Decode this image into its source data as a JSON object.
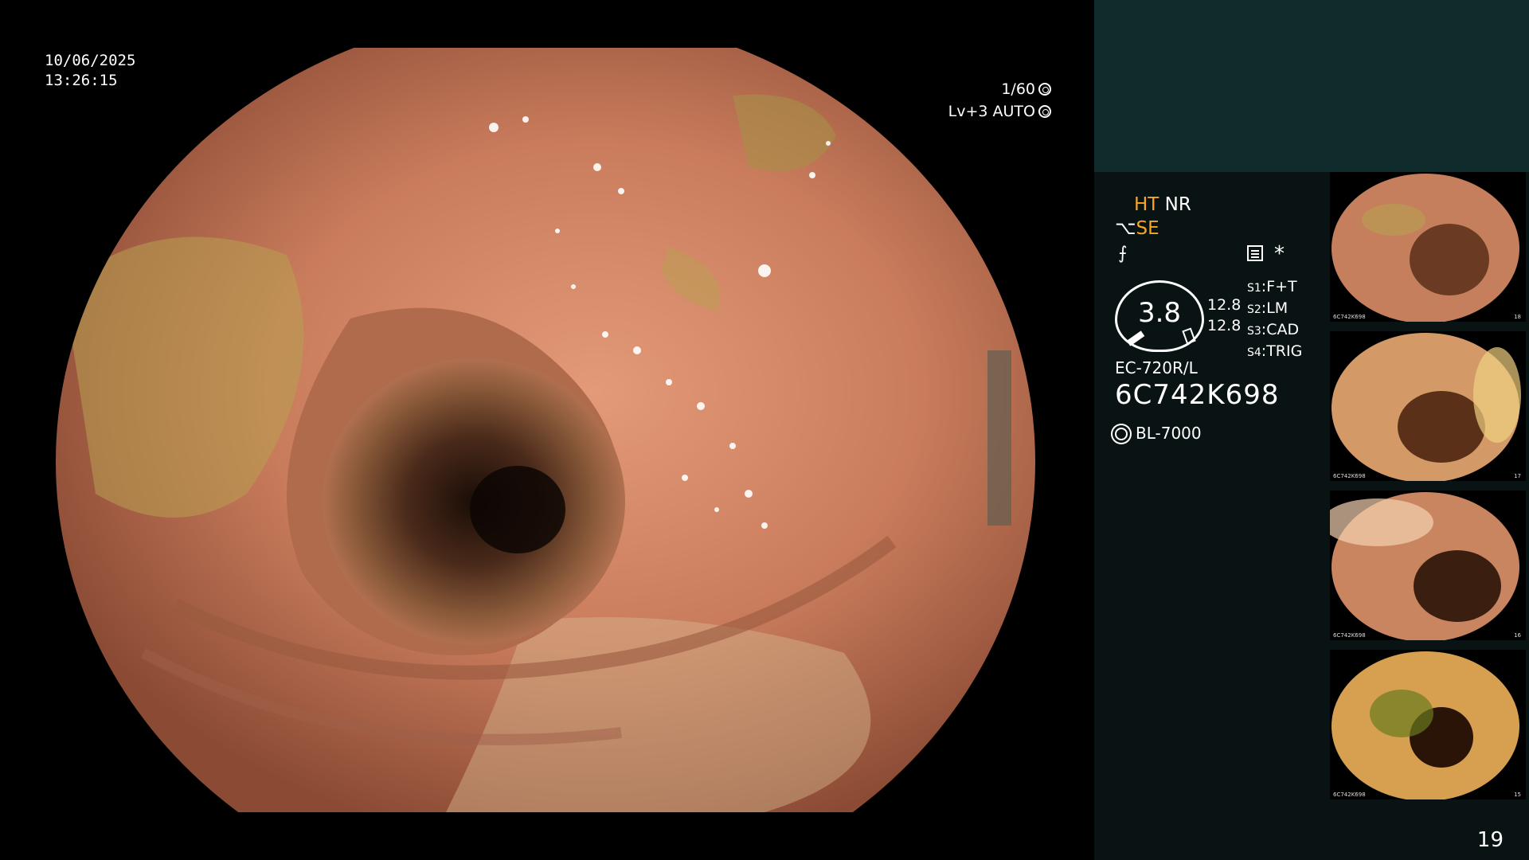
{
  "overlay": {
    "date": "10/06/2025",
    "time": "13:26:15",
    "shutter": "1/60",
    "level": "Lv+3",
    "mode": "AUTO"
  },
  "panel": {
    "ht": "HT",
    "nr": "NR",
    "se": "SE",
    "star": "*",
    "gauge_value": "3.8",
    "gauge_top": "12.8",
    "gauge_bottom": "12.8",
    "switches": [
      {
        "key": "S1",
        "value": "F+T"
      },
      {
        "key": "S2",
        "value": "LM"
      },
      {
        "key": "S3",
        "value": "CAD"
      },
      {
        "key": "S4",
        "value": "TRIG"
      }
    ],
    "model": "EC-720R/L",
    "serial": "6C742K698",
    "light": "BL-7000"
  },
  "thumbnails": [
    {
      "label": "6C742K698",
      "index": "18"
    },
    {
      "label": "6C742K698",
      "index": "17"
    },
    {
      "label": "6C742K698",
      "index": "16"
    },
    {
      "label": "6C742K698",
      "index": "15"
    }
  ],
  "page_number": "19",
  "colors": {
    "accent": "#f6a623",
    "panel_top": "#0f2b2c",
    "panel": "#0a1314",
    "mucosa": "#c77a5a"
  }
}
